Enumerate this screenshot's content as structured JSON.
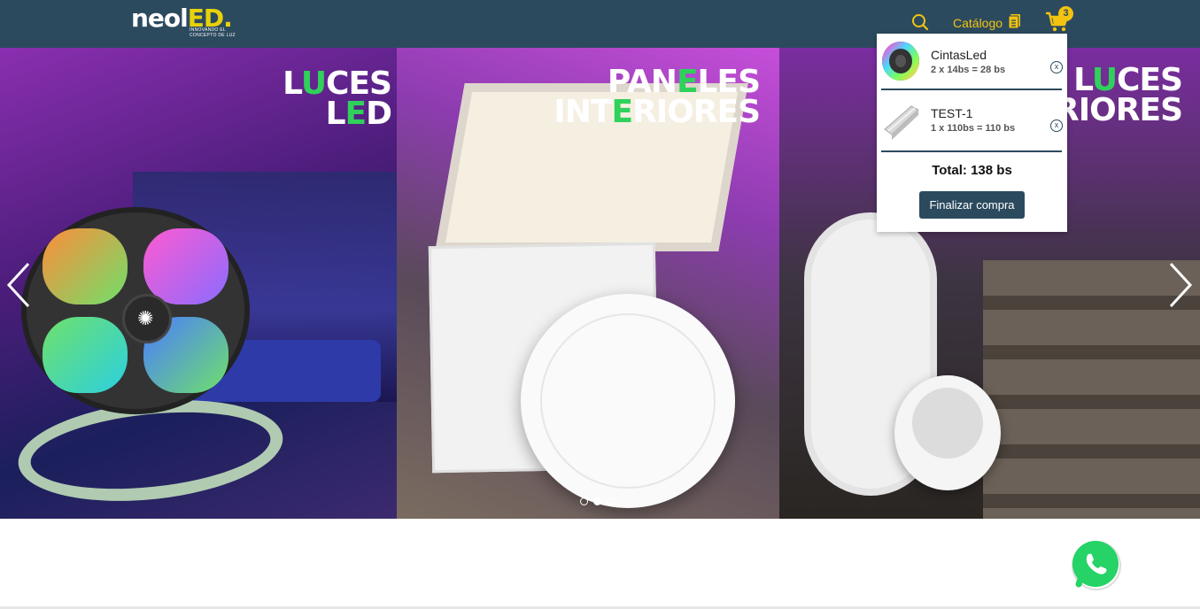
{
  "header": {
    "logo_word_main": "neol",
    "logo_word_accent": "ED.",
    "logo_tagline": "Innovando el concepto de luz",
    "catalog_label": "Catálogo",
    "cart_count": "3",
    "icons": {
      "search": "search-icon",
      "catalog": "catalog-icon",
      "cart": "cart-icon"
    }
  },
  "carousel": {
    "slides": [
      {
        "title_line1": "LUCES",
        "title_line2": "LED",
        "green_letter_1": "U",
        "green_letter_2": "E"
      },
      {
        "title_line1": "PANELES",
        "title_line2": "INTERIORES"
      },
      {
        "title_line1": "LUCES",
        "title_line2": "RIORES"
      }
    ],
    "active_dot": 2,
    "dot_count": 3
  },
  "cart": {
    "items": [
      {
        "name": "CintasLed",
        "price_line": "2 x 14bs = 28 bs",
        "remove_label": "x"
      },
      {
        "name": "TEST-1",
        "price_line": "1 x 110bs = 110 bs",
        "remove_label": "x"
      }
    ],
    "total": "Total: 138 bs",
    "checkout_label": "Finalizar compra"
  },
  "colors": {
    "header_bg": "#2c4a5e",
    "accent_yellow": "#f2c30f",
    "whatsapp_green": "#25d366"
  }
}
